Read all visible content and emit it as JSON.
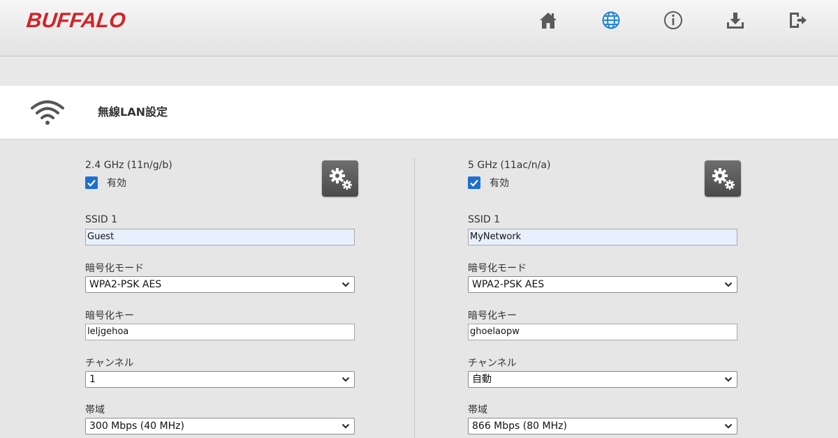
{
  "header": {
    "logo": "BUFFALO",
    "nav_icons": [
      "home-icon",
      "globe-icon",
      "info-icon",
      "download-icon",
      "logout-icon"
    ],
    "brand_color": "#d2232a",
    "active_icon_color": "#1f86d6"
  },
  "page": {
    "title": "無線LAN設定",
    "icon": "wifi-icon"
  },
  "bands": [
    {
      "band_label": "2.4 GHz (11n/g/b)",
      "enabled_label": "有効",
      "enabled": true,
      "ssid_label": "SSID 1",
      "ssid_value": "Guest",
      "encryption_mode_label": "暗号化モード",
      "encryption_mode_value": "WPA2-PSK AES",
      "encryption_key_label": "暗号化キー",
      "encryption_key_value": "leljgehoa",
      "channel_label": "チャンネル",
      "channel_value": "1",
      "bandwidth_label": "帯域",
      "bandwidth_value": "300 Mbps (40 MHz)"
    },
    {
      "band_label": "5 GHz (11ac/n/a)",
      "enabled_label": "有効",
      "enabled": true,
      "ssid_label": "SSID 1",
      "ssid_value": "MyNetwork",
      "encryption_mode_label": "暗号化モード",
      "encryption_mode_value": "WPA2-PSK AES",
      "encryption_key_label": "暗号化キー",
      "encryption_key_value": "ghoelaopw",
      "channel_label": "チャンネル",
      "channel_value": "自動",
      "bandwidth_label": "帯域",
      "bandwidth_value": "866 Mbps (80 MHz)"
    }
  ]
}
